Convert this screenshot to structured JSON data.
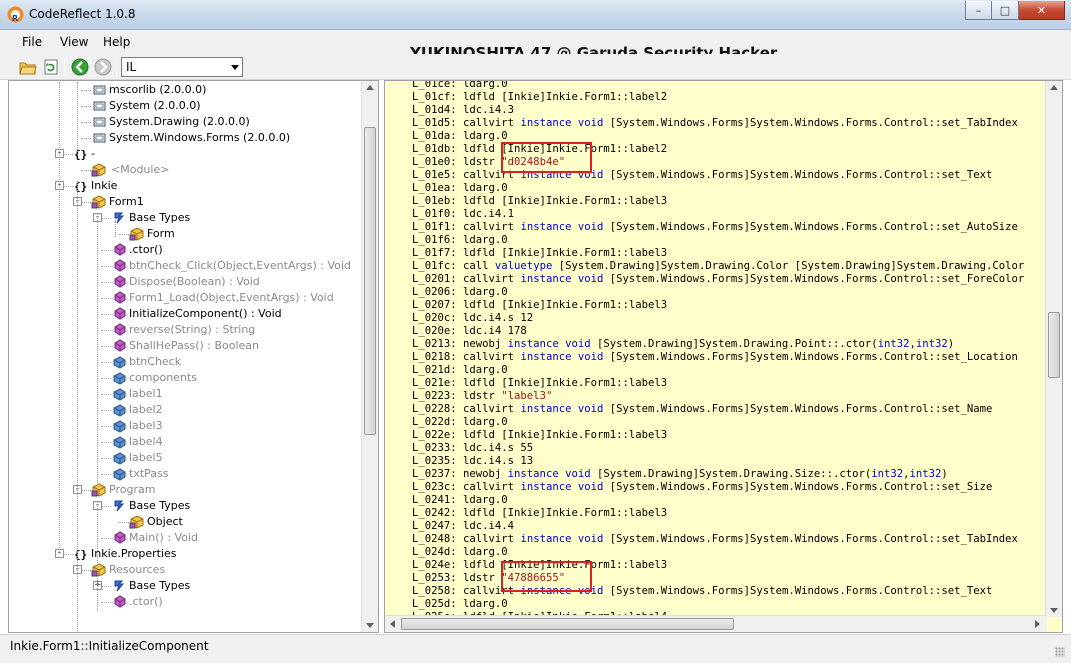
{
  "window": {
    "title": "CodeReflect 1.0.8",
    "buttons": {
      "minimize": "–",
      "maximize": "□",
      "close": "✕"
    }
  },
  "menu": {
    "file": "File",
    "view": "View",
    "help": "Help"
  },
  "overlay_caption": "YUKINOSHITA 47 @ Garuda Security Hacker",
  "toolbar": {
    "icons": [
      "open-folder-icon",
      "refresh-icon",
      "back-icon",
      "forward-icon"
    ],
    "language_select": "IL"
  },
  "tree": {
    "items": [
      {
        "label": "mscorlib (2.0.0.0)",
        "icon": "reference-icon",
        "gray": false
      },
      {
        "label": "System (2.0.0.0)",
        "icon": "reference-icon",
        "gray": false
      },
      {
        "label": "System.Drawing (2.0.0.0)",
        "icon": "reference-icon",
        "gray": false
      },
      {
        "label": "System.Windows.Forms (2.0.0.0)",
        "icon": "reference-icon",
        "gray": false
      },
      {
        "label": "-",
        "icon": "namespace-icon",
        "gray": false
      },
      {
        "label": "<Module>",
        "icon": "class-icon",
        "gray": true
      },
      {
        "label": "Inkie",
        "icon": "namespace-icon",
        "gray": false
      },
      {
        "label": "Form1",
        "icon": "class-icon",
        "gray": false
      },
      {
        "label": "Base Types",
        "icon": "base-types-icon",
        "gray": false
      },
      {
        "label": "Form",
        "icon": "class-icon",
        "gray": false
      },
      {
        "label": ".ctor()",
        "icon": "method-icon",
        "gray": false
      },
      {
        "label": "btnCheck_Click(Object,EventArgs) : Void",
        "icon": "method-icon",
        "gray": true
      },
      {
        "label": "Dispose(Boolean) : Void",
        "icon": "method-icon",
        "gray": true
      },
      {
        "label": "Form1_Load(Object,EventArgs) : Void",
        "icon": "method-icon",
        "gray": true
      },
      {
        "label": "InitializeComponent() : Void",
        "icon": "method-icon",
        "gray": false
      },
      {
        "label": "reverse(String) : String",
        "icon": "method-icon",
        "gray": true
      },
      {
        "label": "ShallHePass() : Boolean",
        "icon": "method-icon",
        "gray": true
      },
      {
        "label": "btnCheck",
        "icon": "field-icon",
        "gray": true
      },
      {
        "label": "components",
        "icon": "field-icon",
        "gray": true
      },
      {
        "label": "label1",
        "icon": "field-icon",
        "gray": true
      },
      {
        "label": "label2",
        "icon": "field-icon",
        "gray": true
      },
      {
        "label": "label3",
        "icon": "field-icon",
        "gray": true
      },
      {
        "label": "label4",
        "icon": "field-icon",
        "gray": true
      },
      {
        "label": "label5",
        "icon": "field-icon",
        "gray": true
      },
      {
        "label": "txtPass",
        "icon": "field-icon",
        "gray": true
      },
      {
        "label": "Program",
        "icon": "class-icon",
        "gray": true
      },
      {
        "label": "Base Types",
        "icon": "base-types-icon",
        "gray": false
      },
      {
        "label": "Object",
        "icon": "class-icon",
        "gray": false
      },
      {
        "label": "Main() : Void",
        "icon": "method-icon",
        "gray": true
      },
      {
        "label": "Inkie.Properties",
        "icon": "namespace-icon",
        "gray": false
      },
      {
        "label": "Resources",
        "icon": "class-icon",
        "gray": true
      },
      {
        "label": "Base Types",
        "icon": "base-types-icon",
        "gray": false
      },
      {
        "label": ".ctor()",
        "icon": "method-icon",
        "gray": true
      }
    ]
  },
  "code": {
    "lines": [
      [
        [
          "L_01ce: ldarg.0",
          ""
        ]
      ],
      [
        [
          "L_01cf: ldfld [Inkie]Inkie.Form1::label2",
          ""
        ]
      ],
      [
        [
          "L_01d4: ldc.i4.3",
          ""
        ]
      ],
      [
        [
          "L_01d5: callvirt ",
          ""
        ],
        [
          "instance void",
          "kw"
        ],
        [
          " [System.Windows.Forms]System.Windows.Forms.Control::set_TabIndex",
          ""
        ]
      ],
      [
        [
          "L_01da: ldarg.0",
          ""
        ]
      ],
      [
        [
          "L_01db: ldfld [Inkie]Inkie.Form1::label2",
          ""
        ]
      ],
      [
        [
          "L_01e0: ldstr ",
          ""
        ],
        [
          "\"d0248b4e\"",
          "str"
        ]
      ],
      [
        [
          "L_01e5: callvirt ",
          ""
        ],
        [
          "instance void",
          "kw"
        ],
        [
          " [System.Windows.Forms]System.Windows.Forms.Control::set_Text",
          ""
        ]
      ],
      [
        [
          "L_01ea: ldarg.0",
          ""
        ]
      ],
      [
        [
          "L_01eb: ldfld [Inkie]Inkie.Form1::label3",
          ""
        ]
      ],
      [
        [
          "L_01f0: ldc.i4.1",
          ""
        ]
      ],
      [
        [
          "L_01f1: callvirt ",
          ""
        ],
        [
          "instance void",
          "kw"
        ],
        [
          " [System.Windows.Forms]System.Windows.Forms.Control::set_AutoSize",
          ""
        ]
      ],
      [
        [
          "L_01f6: ldarg.0",
          ""
        ]
      ],
      [
        [
          "L_01f7: ldfld [Inkie]Inkie.Form1::label3",
          ""
        ]
      ],
      [
        [
          "L_01fc: call ",
          ""
        ],
        [
          "valuetype",
          "kw"
        ],
        [
          " [System.Drawing]System.Drawing.Color [System.Drawing]System.Drawing.Color",
          ""
        ]
      ],
      [
        [
          "L_0201: callvirt ",
          ""
        ],
        [
          "instance void",
          "kw"
        ],
        [
          " [System.Windows.Forms]System.Windows.Forms.Control::set_ForeColor",
          ""
        ]
      ],
      [
        [
          "L_0206: ldarg.0",
          ""
        ]
      ],
      [
        [
          "L_0207: ldfld [Inkie]Inkie.Form1::label3",
          ""
        ]
      ],
      [
        [
          "L_020c: ldc.i4.s 12",
          ""
        ]
      ],
      [
        [
          "L_020e: ldc.i4 178",
          ""
        ]
      ],
      [
        [
          "L_0213: newobj ",
          ""
        ],
        [
          "instance void",
          "kw"
        ],
        [
          " [System.Drawing]System.Drawing.Point::.ctor(",
          ""
        ],
        [
          "int32",
          "kw"
        ],
        [
          ",",
          ""
        ],
        [
          "int32",
          "kw"
        ],
        [
          ")",
          ""
        ]
      ],
      [
        [
          "L_0218: callvirt ",
          ""
        ],
        [
          "instance void",
          "kw"
        ],
        [
          " [System.Windows.Forms]System.Windows.Forms.Control::set_Location",
          ""
        ]
      ],
      [
        [
          "L_021d: ldarg.0",
          ""
        ]
      ],
      [
        [
          "L_021e: ldfld [Inkie]Inkie.Form1::label3",
          ""
        ]
      ],
      [
        [
          "L_0223: ldstr ",
          ""
        ],
        [
          "\"label3\"",
          "str"
        ]
      ],
      [
        [
          "L_0228: callvirt ",
          ""
        ],
        [
          "instance void",
          "kw"
        ],
        [
          " [System.Windows.Forms]System.Windows.Forms.Control::set_Name",
          ""
        ]
      ],
      [
        [
          "L_022d: ldarg.0",
          ""
        ]
      ],
      [
        [
          "L_022e: ldfld [Inkie]Inkie.Form1::label3",
          ""
        ]
      ],
      [
        [
          "L_0233: ldc.i4.s 55",
          ""
        ]
      ],
      [
        [
          "L_0235: ldc.i4.s 13",
          ""
        ]
      ],
      [
        [
          "L_0237: newobj ",
          ""
        ],
        [
          "instance void",
          "kw"
        ],
        [
          " [System.Drawing]System.Drawing.Size::.ctor(",
          ""
        ],
        [
          "int32",
          "kw"
        ],
        [
          ",",
          ""
        ],
        [
          "int32",
          "kw"
        ],
        [
          ")",
          ""
        ]
      ],
      [
        [
          "L_023c: callvirt ",
          ""
        ],
        [
          "instance void",
          "kw"
        ],
        [
          " [System.Windows.Forms]System.Windows.Forms.Control::set_Size",
          ""
        ]
      ],
      [
        [
          "L_0241: ldarg.0",
          ""
        ]
      ],
      [
        [
          "L_0242: ldfld [Inkie]Inkie.Form1::label3",
          ""
        ]
      ],
      [
        [
          "L_0247: ldc.i4.4",
          ""
        ]
      ],
      [
        [
          "L_0248: callvirt ",
          ""
        ],
        [
          "instance void",
          "kw"
        ],
        [
          " [System.Windows.Forms]System.Windows.Forms.Control::set_TabIndex",
          ""
        ]
      ],
      [
        [
          "L_024d: ldarg.0",
          ""
        ]
      ],
      [
        [
          "L_024e: ldfld [Inkie]Inkie.Form1::label3",
          ""
        ]
      ],
      [
        [
          "L_0253: ldstr ",
          ""
        ],
        [
          "\"47886655\"",
          "str"
        ]
      ],
      [
        [
          "L_0258: callvirt ",
          ""
        ],
        [
          "instance void",
          "kw"
        ],
        [
          " [System.Windows.Forms]System.Windows.Forms.Control::set_Text",
          ""
        ]
      ],
      [
        [
          "L_025d: ldarg.0",
          ""
        ]
      ],
      [
        [
          "L_025e: ldfld [Inkie]Inkie.Form1::label4",
          ""
        ]
      ]
    ]
  },
  "status": {
    "text": "Inkie.Form1::InitializeComponent"
  },
  "colors": {
    "code_background": "#ffffcc",
    "keyword": "#0000d0",
    "string": "#a31515",
    "highlight_box": "#e02020"
  }
}
